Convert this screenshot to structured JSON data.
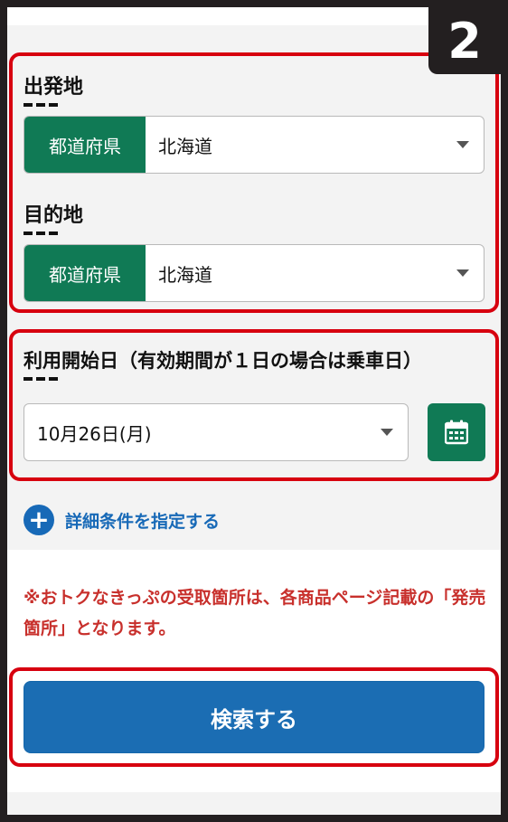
{
  "step_number": "2",
  "departure": {
    "label": "出発地",
    "tag": "都道府県",
    "value": "北海道"
  },
  "destination": {
    "label": "目的地",
    "tag": "都道府県",
    "value": "北海道"
  },
  "start_date": {
    "label": "利用開始日（有効期間が１日の場合は乗車日）",
    "value": "10月26日(月)"
  },
  "detail_link": {
    "label": "詳細条件を指定する"
  },
  "notice": "※おトクなきっぷの受取箇所は、各商品ページ記載の「発売箇所」となります。",
  "search_button": {
    "label": "検索する"
  },
  "colors": {
    "highlight": "#d7000f",
    "green": "#107a55",
    "blue": "#1b6db3",
    "notice_red": "#c8302c"
  },
  "icons": [
    "chevron-down-icon",
    "calendar-icon",
    "plus-circle-icon"
  ]
}
